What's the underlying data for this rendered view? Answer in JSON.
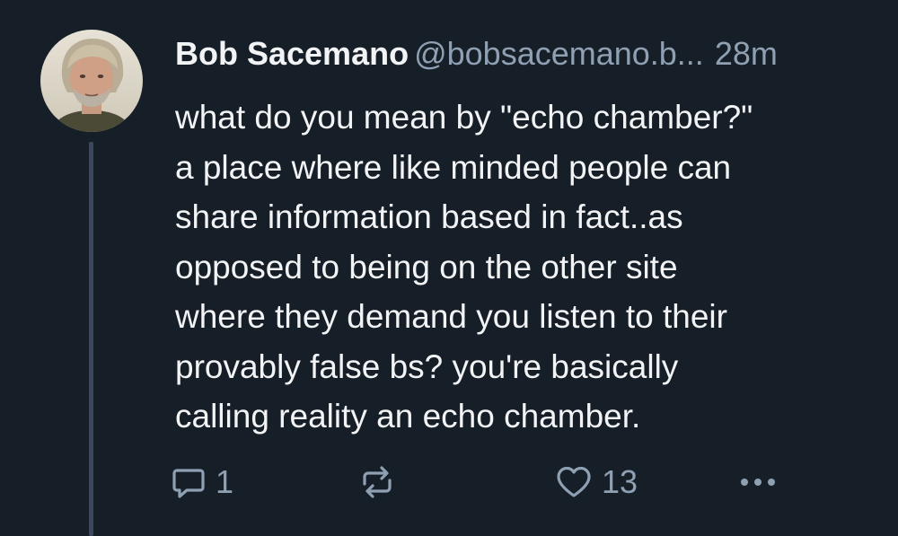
{
  "post": {
    "author": {
      "display_name": "Bob Sacemano",
      "handle": "@bobsacemano.b...",
      "timestamp": "28m"
    },
    "body_lines": [
      "what do you mean by \"echo chamber?\"",
      "a place where like minded people can",
      "share information based in fact..as",
      "opposed to being on the other site",
      "where they demand you listen to their",
      "provably false bs? you're basically",
      "calling reality an echo chamber."
    ],
    "actions": {
      "reply_count": "1",
      "repost_count": "",
      "like_count": "13"
    }
  },
  "colors": {
    "background": "#161e27",
    "primary_text": "#f1f3f5",
    "secondary_text": "#8fa0b3",
    "thread_line": "#3a4a5c"
  },
  "icons": [
    "reply-icon",
    "repost-icon",
    "like-icon",
    "more-icon"
  ]
}
